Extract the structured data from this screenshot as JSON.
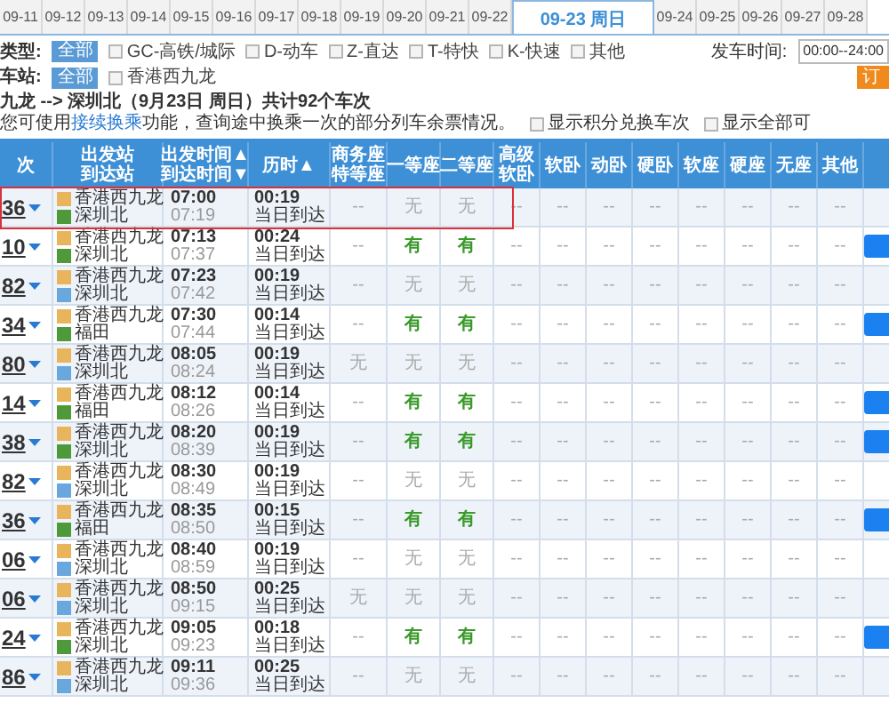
{
  "date_tabs": [
    {
      "label": "09-11",
      "selected": false
    },
    {
      "label": "09-12",
      "selected": false
    },
    {
      "label": "09-13",
      "selected": false
    },
    {
      "label": "09-14",
      "selected": false
    },
    {
      "label": "09-15",
      "selected": false
    },
    {
      "label": "09-16",
      "selected": false
    },
    {
      "label": "09-17",
      "selected": false
    },
    {
      "label": "09-18",
      "selected": false
    },
    {
      "label": "09-19",
      "selected": false
    },
    {
      "label": "09-20",
      "selected": false
    },
    {
      "label": "09-21",
      "selected": false
    },
    {
      "label": "09-22",
      "selected": false
    },
    {
      "label": "09-23 周日",
      "selected": true
    },
    {
      "label": "09-24",
      "selected": false
    },
    {
      "label": "09-25",
      "selected": false
    },
    {
      "label": "09-26",
      "selected": false
    },
    {
      "label": "09-27",
      "selected": false
    },
    {
      "label": "09-28",
      "selected": false
    }
  ],
  "filters": {
    "type_label": "类型:",
    "type_all": "全部",
    "types": [
      {
        "label": "GC-高铁/城际",
        "checked": false
      },
      {
        "label": "D-动车",
        "checked": false
      },
      {
        "label": "Z-直达",
        "checked": false
      },
      {
        "label": "T-特快",
        "checked": false
      },
      {
        "label": "K-快速",
        "checked": false
      },
      {
        "label": "其他",
        "checked": false
      }
    ],
    "departure_time_label": "发车时间:",
    "departure_time_value": "00:00--24:00",
    "station_label": "车站:",
    "station_all": "全部",
    "stations": [
      {
        "label": "香港西九龙",
        "checked": false
      }
    ],
    "action_button": "订"
  },
  "summary": {
    "route": "九龙 --> 深圳北（9月23日  周日）共计92个车次",
    "notice_before": "您可使用",
    "notice_link": "接续换乘",
    "notice_after": "功能，查询途中换乘一次的部分列车余票情况。",
    "options": [
      {
        "label": "显示积分兑换车次",
        "checked": false
      },
      {
        "label": "显示全部可",
        "checked": false
      }
    ]
  },
  "table": {
    "columns": [
      [
        "次"
      ],
      [
        "出发站",
        "到达站"
      ],
      [
        "出发时间▲",
        "到达时间▼"
      ],
      [
        "历时▲"
      ],
      [
        "商务座",
        "特等座"
      ],
      [
        "一等座"
      ],
      [
        "二等座"
      ],
      [
        "高级",
        "软卧"
      ],
      [
        "软卧"
      ],
      [
        "动卧"
      ],
      [
        "硬卧"
      ],
      [
        "软座"
      ],
      [
        "硬座"
      ],
      [
        "无座"
      ],
      [
        "其他"
      ]
    ],
    "rows": [
      {
        "train": "36",
        "from": "香港西九龙",
        "to": "深圳北",
        "to_terminal": true,
        "depart": "07:00",
        "arrive": "07:19",
        "duration": "00:19",
        "arrival_day": "当日到达",
        "highlighted": true,
        "bookable": false,
        "seats": [
          {
            "text": "--",
            "available": false
          },
          {
            "text": "无",
            "available": false
          },
          {
            "text": "无",
            "available": false
          },
          {
            "text": "--",
            "available": false
          },
          {
            "text": "--",
            "available": false
          },
          {
            "text": "--",
            "available": false
          },
          {
            "text": "--",
            "available": false
          },
          {
            "text": "--",
            "available": false
          },
          {
            "text": "--",
            "available": false
          },
          {
            "text": "--",
            "available": false
          },
          {
            "text": "--",
            "available": false
          }
        ]
      },
      {
        "train": "10",
        "from": "香港西九龙",
        "to": "深圳北",
        "to_terminal": true,
        "depart": "07:13",
        "arrive": "07:37",
        "duration": "00:24",
        "arrival_day": "当日到达",
        "highlighted": false,
        "bookable": true,
        "seats": [
          {
            "text": "--",
            "available": false
          },
          {
            "text": "有",
            "available": true
          },
          {
            "text": "有",
            "available": true
          },
          {
            "text": "--",
            "available": false
          },
          {
            "text": "--",
            "available": false
          },
          {
            "text": "--",
            "available": false
          },
          {
            "text": "--",
            "available": false
          },
          {
            "text": "--",
            "available": false
          },
          {
            "text": "--",
            "available": false
          },
          {
            "text": "--",
            "available": false
          },
          {
            "text": "--",
            "available": false
          }
        ]
      },
      {
        "train": "82",
        "from": "香港西九龙",
        "to": "深圳北",
        "to_terminal": false,
        "depart": "07:23",
        "arrive": "07:42",
        "duration": "00:19",
        "arrival_day": "当日到达",
        "highlighted": false,
        "bookable": false,
        "seats": [
          {
            "text": "--",
            "available": false
          },
          {
            "text": "无",
            "available": false
          },
          {
            "text": "无",
            "available": false
          },
          {
            "text": "--",
            "available": false
          },
          {
            "text": "--",
            "available": false
          },
          {
            "text": "--",
            "available": false
          },
          {
            "text": "--",
            "available": false
          },
          {
            "text": "--",
            "available": false
          },
          {
            "text": "--",
            "available": false
          },
          {
            "text": "--",
            "available": false
          },
          {
            "text": "--",
            "available": false
          }
        ]
      },
      {
        "train": "34",
        "from": "香港西九龙",
        "to": "福田",
        "to_terminal": true,
        "depart": "07:30",
        "arrive": "07:44",
        "duration": "00:14",
        "arrival_day": "当日到达",
        "highlighted": false,
        "bookable": true,
        "seats": [
          {
            "text": "--",
            "available": false
          },
          {
            "text": "有",
            "available": true
          },
          {
            "text": "有",
            "available": true
          },
          {
            "text": "--",
            "available": false
          },
          {
            "text": "--",
            "available": false
          },
          {
            "text": "--",
            "available": false
          },
          {
            "text": "--",
            "available": false
          },
          {
            "text": "--",
            "available": false
          },
          {
            "text": "--",
            "available": false
          },
          {
            "text": "--",
            "available": false
          },
          {
            "text": "--",
            "available": false
          }
        ]
      },
      {
        "train": "80",
        "from": "香港西九龙",
        "to": "深圳北",
        "to_terminal": false,
        "depart": "08:05",
        "arrive": "08:24",
        "duration": "00:19",
        "arrival_day": "当日到达",
        "highlighted": false,
        "bookable": false,
        "seats": [
          {
            "text": "无",
            "available": false
          },
          {
            "text": "无",
            "available": false
          },
          {
            "text": "无",
            "available": false
          },
          {
            "text": "--",
            "available": false
          },
          {
            "text": "--",
            "available": false
          },
          {
            "text": "--",
            "available": false
          },
          {
            "text": "--",
            "available": false
          },
          {
            "text": "--",
            "available": false
          },
          {
            "text": "--",
            "available": false
          },
          {
            "text": "--",
            "available": false
          },
          {
            "text": "--",
            "available": false
          }
        ]
      },
      {
        "train": "14",
        "from": "香港西九龙",
        "to": "福田",
        "to_terminal": true,
        "depart": "08:12",
        "arrive": "08:26",
        "duration": "00:14",
        "arrival_day": "当日到达",
        "highlighted": false,
        "bookable": true,
        "seats": [
          {
            "text": "--",
            "available": false
          },
          {
            "text": "有",
            "available": true
          },
          {
            "text": "有",
            "available": true
          },
          {
            "text": "--",
            "available": false
          },
          {
            "text": "--",
            "available": false
          },
          {
            "text": "--",
            "available": false
          },
          {
            "text": "--",
            "available": false
          },
          {
            "text": "--",
            "available": false
          },
          {
            "text": "--",
            "available": false
          },
          {
            "text": "--",
            "available": false
          },
          {
            "text": "--",
            "available": false
          }
        ]
      },
      {
        "train": "38",
        "from": "香港西九龙",
        "to": "深圳北",
        "to_terminal": true,
        "depart": "08:20",
        "arrive": "08:39",
        "duration": "00:19",
        "arrival_day": "当日到达",
        "highlighted": false,
        "bookable": true,
        "seats": [
          {
            "text": "--",
            "available": false
          },
          {
            "text": "有",
            "available": true
          },
          {
            "text": "有",
            "available": true
          },
          {
            "text": "--",
            "available": false
          },
          {
            "text": "--",
            "available": false
          },
          {
            "text": "--",
            "available": false
          },
          {
            "text": "--",
            "available": false
          },
          {
            "text": "--",
            "available": false
          },
          {
            "text": "--",
            "available": false
          },
          {
            "text": "--",
            "available": false
          },
          {
            "text": "--",
            "available": false
          }
        ]
      },
      {
        "train": "82",
        "from": "香港西九龙",
        "to": "深圳北",
        "to_terminal": false,
        "depart": "08:30",
        "arrive": "08:49",
        "duration": "00:19",
        "arrival_day": "当日到达",
        "highlighted": false,
        "bookable": false,
        "seats": [
          {
            "text": "--",
            "available": false
          },
          {
            "text": "无",
            "available": false
          },
          {
            "text": "无",
            "available": false
          },
          {
            "text": "--",
            "available": false
          },
          {
            "text": "--",
            "available": false
          },
          {
            "text": "--",
            "available": false
          },
          {
            "text": "--",
            "available": false
          },
          {
            "text": "--",
            "available": false
          },
          {
            "text": "--",
            "available": false
          },
          {
            "text": "--",
            "available": false
          },
          {
            "text": "--",
            "available": false
          }
        ]
      },
      {
        "train": "36",
        "from": "香港西九龙",
        "to": "福田",
        "to_terminal": true,
        "depart": "08:35",
        "arrive": "08:50",
        "duration": "00:15",
        "arrival_day": "当日到达",
        "highlighted": false,
        "bookable": true,
        "seats": [
          {
            "text": "--",
            "available": false
          },
          {
            "text": "有",
            "available": true
          },
          {
            "text": "有",
            "available": true
          },
          {
            "text": "--",
            "available": false
          },
          {
            "text": "--",
            "available": false
          },
          {
            "text": "--",
            "available": false
          },
          {
            "text": "--",
            "available": false
          },
          {
            "text": "--",
            "available": false
          },
          {
            "text": "--",
            "available": false
          },
          {
            "text": "--",
            "available": false
          },
          {
            "text": "--",
            "available": false
          }
        ]
      },
      {
        "train": "06",
        "from": "香港西九龙",
        "to": "深圳北",
        "to_terminal": false,
        "depart": "08:40",
        "arrive": "08:59",
        "duration": "00:19",
        "arrival_day": "当日到达",
        "highlighted": false,
        "bookable": false,
        "seats": [
          {
            "text": "--",
            "available": false
          },
          {
            "text": "无",
            "available": false
          },
          {
            "text": "无",
            "available": false
          },
          {
            "text": "--",
            "available": false
          },
          {
            "text": "--",
            "available": false
          },
          {
            "text": "--",
            "available": false
          },
          {
            "text": "--",
            "available": false
          },
          {
            "text": "--",
            "available": false
          },
          {
            "text": "--",
            "available": false
          },
          {
            "text": "--",
            "available": false
          },
          {
            "text": "--",
            "available": false
          }
        ]
      },
      {
        "train": "06",
        "from": "香港西九龙",
        "to": "深圳北",
        "to_terminal": false,
        "depart": "08:50",
        "arrive": "09:15",
        "duration": "00:25",
        "arrival_day": "当日到达",
        "highlighted": false,
        "bookable": false,
        "seats": [
          {
            "text": "无",
            "available": false
          },
          {
            "text": "无",
            "available": false
          },
          {
            "text": "无",
            "available": false
          },
          {
            "text": "--",
            "available": false
          },
          {
            "text": "--",
            "available": false
          },
          {
            "text": "--",
            "available": false
          },
          {
            "text": "--",
            "available": false
          },
          {
            "text": "--",
            "available": false
          },
          {
            "text": "--",
            "available": false
          },
          {
            "text": "--",
            "available": false
          },
          {
            "text": "--",
            "available": false
          }
        ]
      },
      {
        "train": "24",
        "from": "香港西九龙",
        "to": "深圳北",
        "to_terminal": true,
        "depart": "09:05",
        "arrive": "09:23",
        "duration": "00:18",
        "arrival_day": "当日到达",
        "highlighted": false,
        "bookable": true,
        "seats": [
          {
            "text": "--",
            "available": false
          },
          {
            "text": "有",
            "available": true
          },
          {
            "text": "有",
            "available": true
          },
          {
            "text": "--",
            "available": false
          },
          {
            "text": "--",
            "available": false
          },
          {
            "text": "--",
            "available": false
          },
          {
            "text": "--",
            "available": false
          },
          {
            "text": "--",
            "available": false
          },
          {
            "text": "--",
            "available": false
          },
          {
            "text": "--",
            "available": false
          },
          {
            "text": "--",
            "available": false
          }
        ]
      },
      {
        "train": "86",
        "from": "香港西九龙",
        "to": "深圳北",
        "to_terminal": false,
        "depart": "09:11",
        "arrive": "09:36",
        "duration": "00:25",
        "arrival_day": "当日到达",
        "highlighted": false,
        "bookable": false,
        "seats": [
          {
            "text": "--",
            "available": false
          },
          {
            "text": "无",
            "available": false
          },
          {
            "text": "无",
            "available": false
          },
          {
            "text": "--",
            "available": false
          },
          {
            "text": "--",
            "available": false
          },
          {
            "text": "--",
            "available": false
          },
          {
            "text": "--",
            "available": false
          },
          {
            "text": "--",
            "available": false
          },
          {
            "text": "--",
            "available": false
          },
          {
            "text": "--",
            "available": false
          },
          {
            "text": "--",
            "available": false
          }
        ]
      }
    ]
  }
}
